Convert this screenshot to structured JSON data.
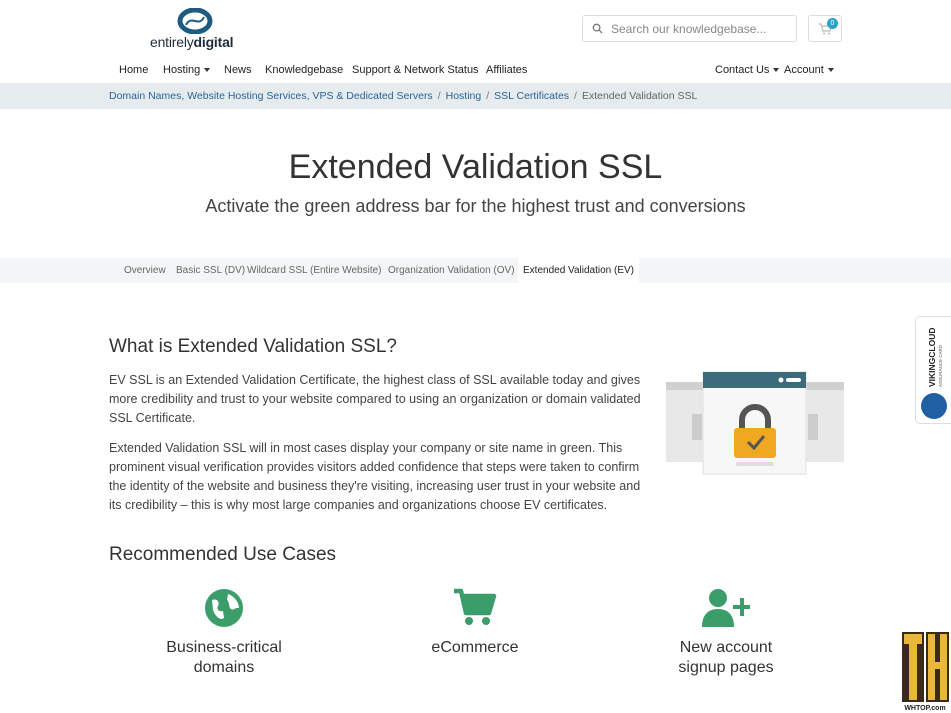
{
  "brand": {
    "logo_prefix": "entirely",
    "logo_suffix": "digital",
    "accent": "#1d5b80"
  },
  "search": {
    "placeholder": "Search our knowledgebase..."
  },
  "cart": {
    "count": "0"
  },
  "nav": {
    "home": "Home",
    "hosting": "Hosting",
    "news": "News",
    "knowledgebase": "Knowledgebase",
    "support": "Support & Network Status",
    "affiliates": "Affiliates",
    "contact": "Contact Us",
    "account": "Account"
  },
  "breadcrumb": {
    "items": [
      "Domain Names, Website Hosting Services, VPS & Dedicated Servers",
      "Hosting",
      "SSL Certificates"
    ],
    "current": "Extended Validation SSL"
  },
  "hero": {
    "title": "Extended Validation SSL",
    "subtitle": "Activate the green address bar for the highest trust and conversions"
  },
  "subnav": {
    "items": [
      "Overview",
      "Basic SSL (DV)",
      "Wildcard SSL (Entire Website)",
      "Organization Validation (OV)",
      "Extended Validation (EV)"
    ],
    "active_index": 4
  },
  "about": {
    "heading": "What is Extended Validation SSL?",
    "para1": "EV SSL is an Extended Validation Certificate, the highest class of SSL available today and gives more credibility and trust to your website compared to using an organization or domain validated SSL Certificate.",
    "para2": "Extended Validation SSL will in most cases display your company or site name in green. This prominent visual verification provides visitors added confidence that steps were taken to confirm the identity of the website and business they're visiting, increasing user trust in your website and its credibility – this is why most large companies and organizations choose EV certificates."
  },
  "usecases": {
    "heading": "Recommended Use Cases",
    "items": [
      {
        "label": "Business-critical domains",
        "icon": "globe-icon"
      },
      {
        "label": "eCommerce",
        "icon": "shopping-cart-icon"
      },
      {
        "label": "New account signup pages",
        "icon": "user-plus-icon"
      }
    ],
    "icon_color": "#3a9d6a"
  },
  "side_badge": {
    "brand": "VIKINGCLOUD",
    "tagline": "ASSURANCE CARD"
  },
  "watermark": {
    "text": "WHTOP.com"
  }
}
